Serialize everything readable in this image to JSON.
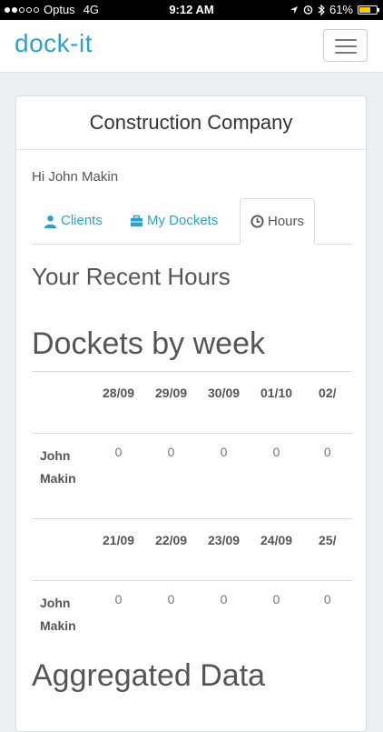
{
  "status_bar": {
    "carrier": "Optus",
    "network": "4G",
    "time": "9:12 AM",
    "battery": "61%",
    "signal_bars": 2
  },
  "navbar": {
    "logo_text": "dock-it"
  },
  "card": {
    "title": "Construction Company",
    "greeting": "Hi John Makin",
    "tabs": [
      {
        "label": "Clients",
        "icon": "user-icon"
      },
      {
        "label": "My Dockets",
        "icon": "briefcase-icon"
      },
      {
        "label": "Hours",
        "icon": "clock-icon",
        "active": true
      }
    ],
    "recent_hours_title": "Your Recent Hours",
    "dockets_title": "Dockets by week",
    "weeks": [
      {
        "dates": [
          "28/09",
          "29/09",
          "30/09",
          "01/10",
          "02/"
        ],
        "rows": [
          {
            "name": "John Makin",
            "values": [
              "0",
              "0",
              "0",
              "0",
              "0"
            ]
          }
        ]
      },
      {
        "dates": [
          "21/09",
          "22/09",
          "23/09",
          "24/09",
          "25/"
        ],
        "rows": [
          {
            "name": "John Makin",
            "values": [
              "0",
              "0",
              "0",
              "0",
              "0"
            ]
          }
        ]
      }
    ],
    "aggregated_title": "Aggregated Data"
  },
  "colors": {
    "accent": "#2aa3cc",
    "battery": "#ffcc00"
  }
}
